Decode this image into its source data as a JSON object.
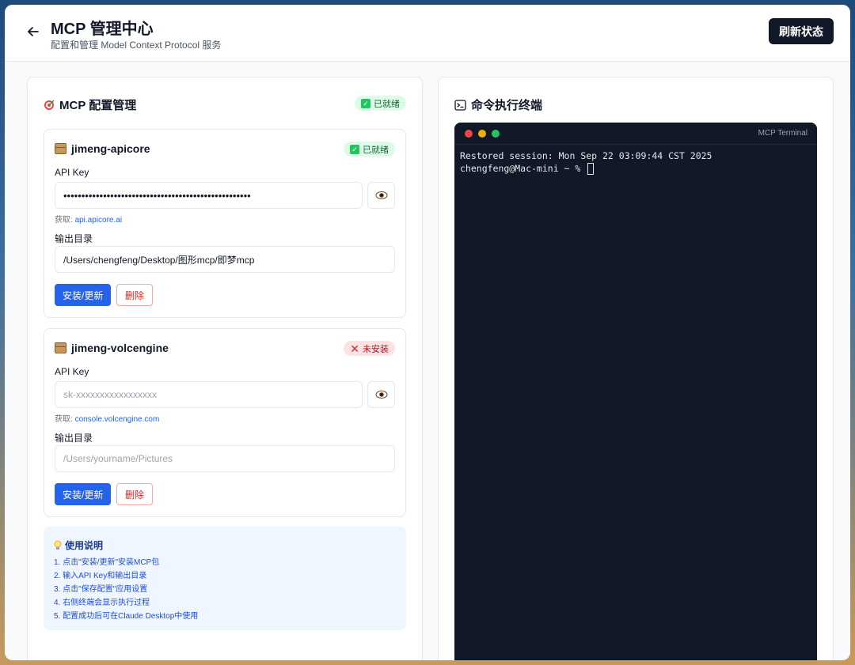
{
  "header": {
    "title": "MCP 管理中心",
    "subtitle": "配置和管理 Model Context Protocol 服务",
    "refresh_label": "刷新状态"
  },
  "config_panel": {
    "title": "MCP 配置管理",
    "status": "已就绪",
    "packages": [
      {
        "name": "jimeng-apicore",
        "status": "已就绪",
        "api_key_label": "API Key",
        "api_key_value": "••••••••••••••••••••••••••••••••••••••••••••••••••••",
        "api_key_placeholder": "",
        "hint_prefix": "获取:",
        "hint_link": "api.apicore.ai",
        "output_label": "输出目录",
        "output_value": "/Users/chengfeng/Desktop/图形mcp/即梦mcp",
        "output_placeholder": "",
        "install_label": "安装/更新",
        "delete_label": "删除"
      },
      {
        "name": "jimeng-volcengine",
        "status": "未安装",
        "api_key_label": "API Key",
        "api_key_value": "",
        "api_key_placeholder": "sk-xxxxxxxxxxxxxxxxx",
        "hint_prefix": "获取:",
        "hint_link": "console.volcengine.com",
        "output_label": "输出目录",
        "output_value": "",
        "output_placeholder": "/Users/yourname/Pictures",
        "install_label": "安装/更新",
        "delete_label": "删除"
      }
    ],
    "help": {
      "title": "使用说明",
      "steps": [
        "1. 点击\"安装/更新\"安装MCP包",
        "2. 输入API Key和输出目录",
        "3. 点击\"保存配置\"应用设置",
        "4. 右侧终端会显示执行过程",
        "5. 配置成功后可在Claude Desktop中使用"
      ]
    }
  },
  "terminal_panel": {
    "title": "命令执行终端",
    "window_title": "MCP Terminal",
    "lines": [
      "Restored session: Mon Sep 22 03:09:44 CST 2025",
      "chengfeng@Mac-mini ~ % "
    ]
  },
  "colors": {
    "primary": "#2563eb",
    "dark": "#111827",
    "success_bg": "#dcfce7",
    "error_bg": "#fee2e2"
  },
  "icons": {
    "back": "arrow-left-icon",
    "target": "target-icon",
    "package": "package-icon",
    "eye": "eye-icon",
    "bulb": "lightbulb-icon",
    "terminal": "terminal-icon"
  }
}
